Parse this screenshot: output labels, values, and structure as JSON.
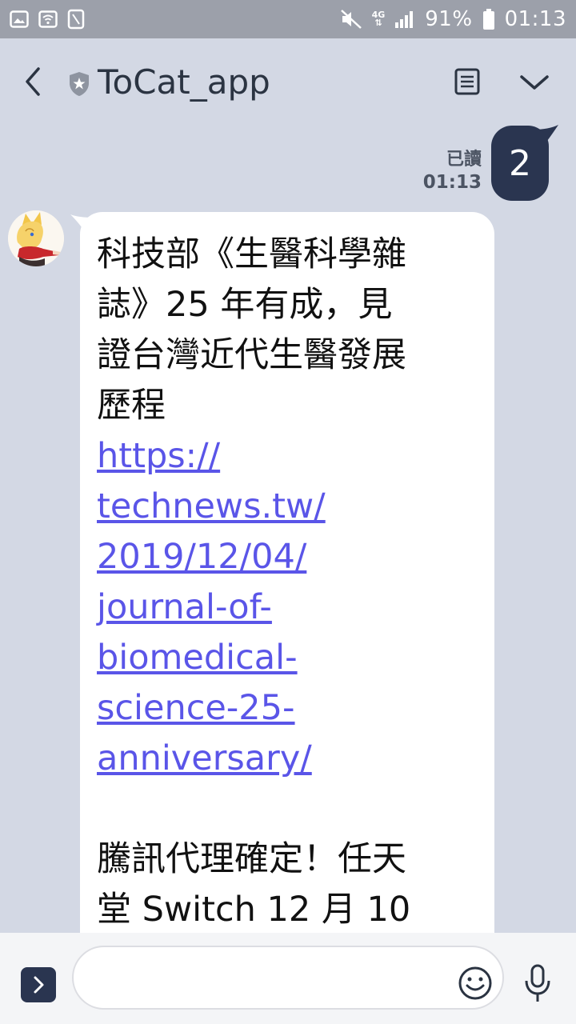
{
  "status_bar": {
    "battery": "91%",
    "time": "01:13",
    "network": "4G"
  },
  "header": {
    "title": "ToCat_app"
  },
  "sent": {
    "text": "2",
    "read_label": "已讀",
    "time": "01:13"
  },
  "received": {
    "lines": [
      "科技部《生醫科學雜",
      "誌》25 年有成，見",
      "證台灣近代生醫發展",
      "歷程"
    ],
    "link_lines": [
      "https://",
      "technews.tw/",
      "2019/12/04/",
      "journal-of-",
      "biomedical-",
      "science-25-",
      "anniversary/"
    ],
    "lines2": [
      "騰訊代理確定！任天",
      "堂 Switch 12 月 10"
    ]
  },
  "input": {
    "placeholder": ""
  },
  "colors": {
    "background": "#d3d8e4",
    "accent": "#2a3550",
    "link": "#5a55e8"
  }
}
